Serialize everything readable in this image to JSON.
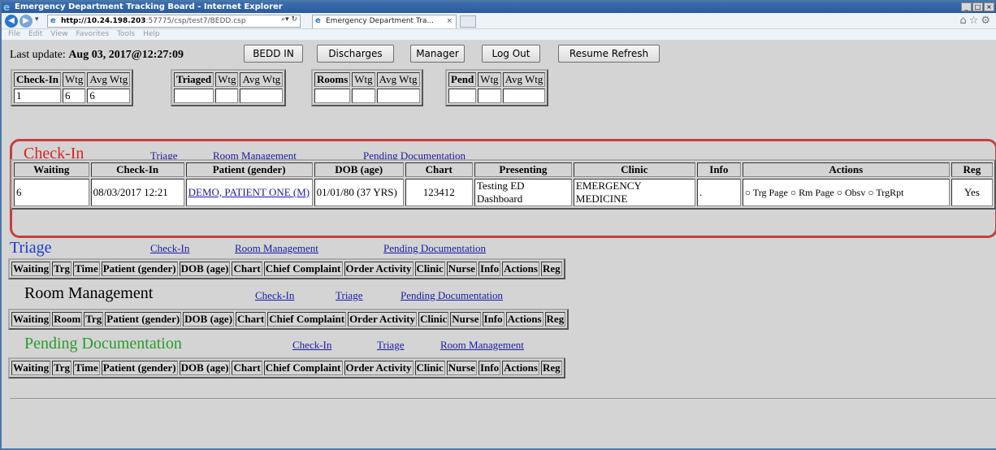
{
  "browser": {
    "title": "Emergency Department Tracking Board - Internet Explorer",
    "url_host": "http://10.24.198.203",
    "url_path": ":57775/csp/test7/BEDD.csp",
    "tab_title": "Emergency Department Tra...",
    "menu": [
      "File",
      "Edit",
      "View",
      "Favorites",
      "Tools",
      "Help"
    ]
  },
  "toolbar": {
    "last_update_label": "Last update:",
    "last_update_value": "Aug 03, 2017@12:27:09",
    "buttons": [
      "BEDD IN",
      "Discharges",
      "Manager",
      "Log Out",
      "Resume Refresh"
    ]
  },
  "summary": [
    {
      "headers": [
        "Check-In",
        "Wtg",
        "Avg Wtg"
      ],
      "values": [
        "1",
        "6",
        "6"
      ]
    },
    {
      "headers": [
        "Triaged",
        "Wtg",
        "Avg Wtg"
      ],
      "values": [
        "",
        "",
        ""
      ]
    },
    {
      "headers": [
        "Rooms",
        "Wtg",
        "Avg Wtg"
      ],
      "values": [
        "",
        "",
        ""
      ]
    },
    {
      "headers": [
        "Pend",
        "Wtg",
        "Avg Wtg"
      ],
      "values": [
        "",
        "",
        ""
      ]
    }
  ],
  "checkin": {
    "title": "Check-In",
    "links": [
      "Triage",
      "Room Management",
      "Pending Documentation"
    ],
    "headers": [
      "Waiting",
      "Check-In",
      "Patient (gender)",
      "DOB (age)",
      "Chart",
      "Presenting",
      "Clinic",
      "Info",
      "Actions",
      "Reg"
    ],
    "row": {
      "waiting": "6",
      "checkin": "08/03/2017 12:21",
      "patient": "DEMO, PATIENT ONE (M)",
      "dob": "01/01/80 (37 YRS)",
      "chart": "123412",
      "presenting": "Testing ED Dashboard",
      "clinic": "EMERGENCY MEDICINE",
      "info": ".",
      "actions": [
        "Trg Page",
        "Rm Page",
        "Obsv",
        "TrgRpt"
      ],
      "reg": "Yes"
    }
  },
  "triage": {
    "title": "Triage",
    "links": [
      "Check-In",
      "Room Management",
      "Pending Documentation"
    ],
    "headers": [
      "Waiting",
      "Trg",
      "Time",
      "Patient (gender)",
      "DOB (age)",
      "Chart",
      "Chief Complaint",
      "Order Activity",
      "Clinic",
      "Nurse",
      "Info",
      "Actions",
      "Reg"
    ]
  },
  "room": {
    "title": "Room Management",
    "links": [
      "Check-In",
      "Triage",
      "Pending Documentation"
    ],
    "headers": [
      "Waiting",
      "Room",
      "Trg",
      "Patient (gender)",
      "DOB (age)",
      "Chart",
      "Chief Complaint",
      "Order Activity",
      "Clinic",
      "Nurse",
      "Info",
      "Actions",
      "Reg"
    ]
  },
  "pending": {
    "title": "Pending Documentation",
    "links": [
      "Check-In",
      "Triage",
      "Room Management"
    ],
    "headers": [
      "Waiting",
      "Trg",
      "Time",
      "Patient (gender)",
      "DOB (age)",
      "Chart",
      "Chief Complaint",
      "Order Activity",
      "Clinic",
      "Nurse",
      "Info",
      "Actions",
      "Reg"
    ]
  }
}
